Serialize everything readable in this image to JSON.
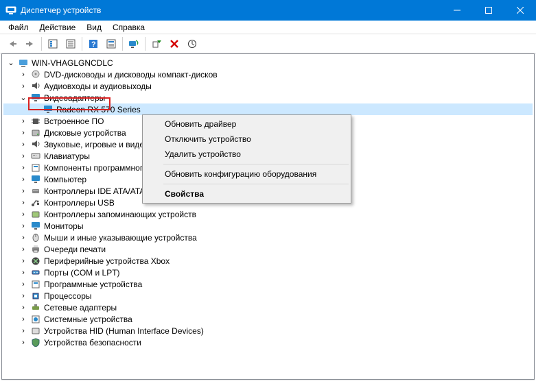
{
  "title": "Диспетчер устройств",
  "menu": {
    "file": "Файл",
    "action": "Действие",
    "view": "Вид",
    "help": "Справка"
  },
  "root": "WIN-VHAGLGNCDLC",
  "selected_node": "Radeon RX 570 Series",
  "categories": [
    {
      "label": "DVD-дисководы и дисководы компакт-дисков",
      "icon": "disc"
    },
    {
      "label": "Аудиовходы и аудиовыходы",
      "icon": "audio"
    },
    {
      "label": "Видеоадаптеры",
      "icon": "display",
      "expanded": true,
      "highlight": true,
      "children": [
        {
          "label": "Radeon RX 570 Series",
          "icon": "display",
          "selected": true
        }
      ]
    },
    {
      "label": "Встроенное ПО",
      "icon": "chip"
    },
    {
      "label": "Дисковые устройства",
      "icon": "disk"
    },
    {
      "label": "Звуковые, игровые и видеоустройства",
      "icon": "audio"
    },
    {
      "label": "Клавиатуры",
      "icon": "keyboard"
    },
    {
      "label": "Компоненты программного обеспечения",
      "icon": "sw"
    },
    {
      "label": "Компьютер",
      "icon": "pc"
    },
    {
      "label": "Контроллеры IDE ATA/ATAPI",
      "icon": "ide"
    },
    {
      "label": "Контроллеры USB",
      "icon": "usb"
    },
    {
      "label": "Контроллеры запоминающих устройств",
      "icon": "storage"
    },
    {
      "label": "Мониторы",
      "icon": "monitor"
    },
    {
      "label": "Мыши и иные указывающие устройства",
      "icon": "mouse"
    },
    {
      "label": "Очереди печати",
      "icon": "printer"
    },
    {
      "label": "Периферийные устройства Xbox",
      "icon": "xbox"
    },
    {
      "label": "Порты (COM и LPT)",
      "icon": "port"
    },
    {
      "label": "Программные устройства",
      "icon": "sw"
    },
    {
      "label": "Процессоры",
      "icon": "cpu"
    },
    {
      "label": "Сетевые адаптеры",
      "icon": "net"
    },
    {
      "label": "Системные устройства",
      "icon": "system"
    },
    {
      "label": "Устройства HID (Human Interface Devices)",
      "icon": "hid"
    },
    {
      "label": "Устройства безопасности",
      "icon": "security"
    }
  ],
  "context_menu": {
    "update": "Обновить драйвер",
    "disable": "Отключить устройство",
    "uninstall": "Удалить устройство",
    "scan": "Обновить конфигурацию оборудования",
    "properties": "Свойства"
  },
  "colors": {
    "title_bg": "#0078d7",
    "highlight": "#d92222",
    "select": "#cce8ff"
  }
}
